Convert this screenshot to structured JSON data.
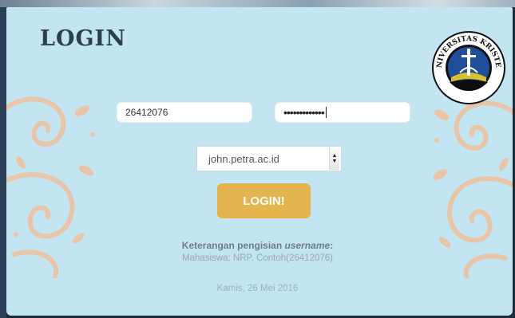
{
  "page": {
    "title": "LOGIN",
    "logo": {
      "icon": "ukp-logo-icon",
      "text_top": "UNIVERSITAS KRISTEN",
      "text_bottom": "PETRA"
    }
  },
  "form": {
    "username": {
      "value": "26412076"
    },
    "password": {
      "value": "•••••••••••••"
    },
    "domain": {
      "value": "john.petra.ac.id"
    },
    "submit_label": "LOGIN!"
  },
  "info": {
    "title_prefix": "Keterangan pengisian ",
    "title_emph": "username",
    "title_suffix": ":",
    "text": "Mahasiswa: NRP. Contoh(26412076)"
  },
  "footer": {
    "date": "Kamis, 26 Mei 2016"
  },
  "colors": {
    "panel": "#c3e5f1",
    "button": "#e4b44e",
    "title": "#2c3e50",
    "swirl": "#e8c5a8"
  }
}
